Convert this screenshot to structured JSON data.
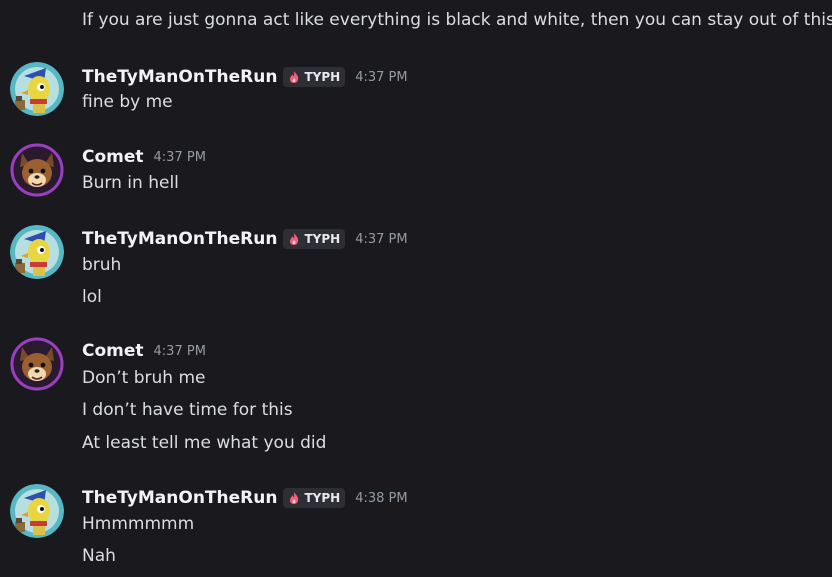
{
  "prev_message": {
    "text": "If you are just gonna act like everything is black and white, then you can stay out of this"
  },
  "messages": [
    {
      "author": "TheTyManOnTheRun",
      "tag": "TYPH",
      "time": "4:37 PM",
      "lines": [
        "fine by me"
      ]
    },
    {
      "author": "Comet",
      "time": "4:37 PM",
      "lines": [
        "Burn in hell"
      ]
    },
    {
      "author": "TheTyManOnTheRun",
      "tag": "TYPH",
      "time": "4:37 PM",
      "lines": [
        "bruh",
        "lol"
      ]
    },
    {
      "author": "Comet",
      "time": "4:37 PM",
      "lines": [
        "Don’t bruh me",
        "I don’t have time for this",
        "At least tell me what you did"
      ]
    },
    {
      "author": "TheTyManOnTheRun",
      "tag": "TYPH",
      "time": "4:38 PM",
      "lines": [
        "Hmmmmmm",
        "Nah"
      ]
    }
  ],
  "colors": {
    "background": "#1a1a1e",
    "username": "#f2f3f5",
    "text": "#dbdee1",
    "timestamp": "#949ba4",
    "tag_bg": "#2e2f35",
    "tag_flame": "#f0607a"
  },
  "icons": {
    "tag": "flame-icon",
    "avatar_ty": "penguin-avatar",
    "avatar_comet": "fox-avatar"
  }
}
